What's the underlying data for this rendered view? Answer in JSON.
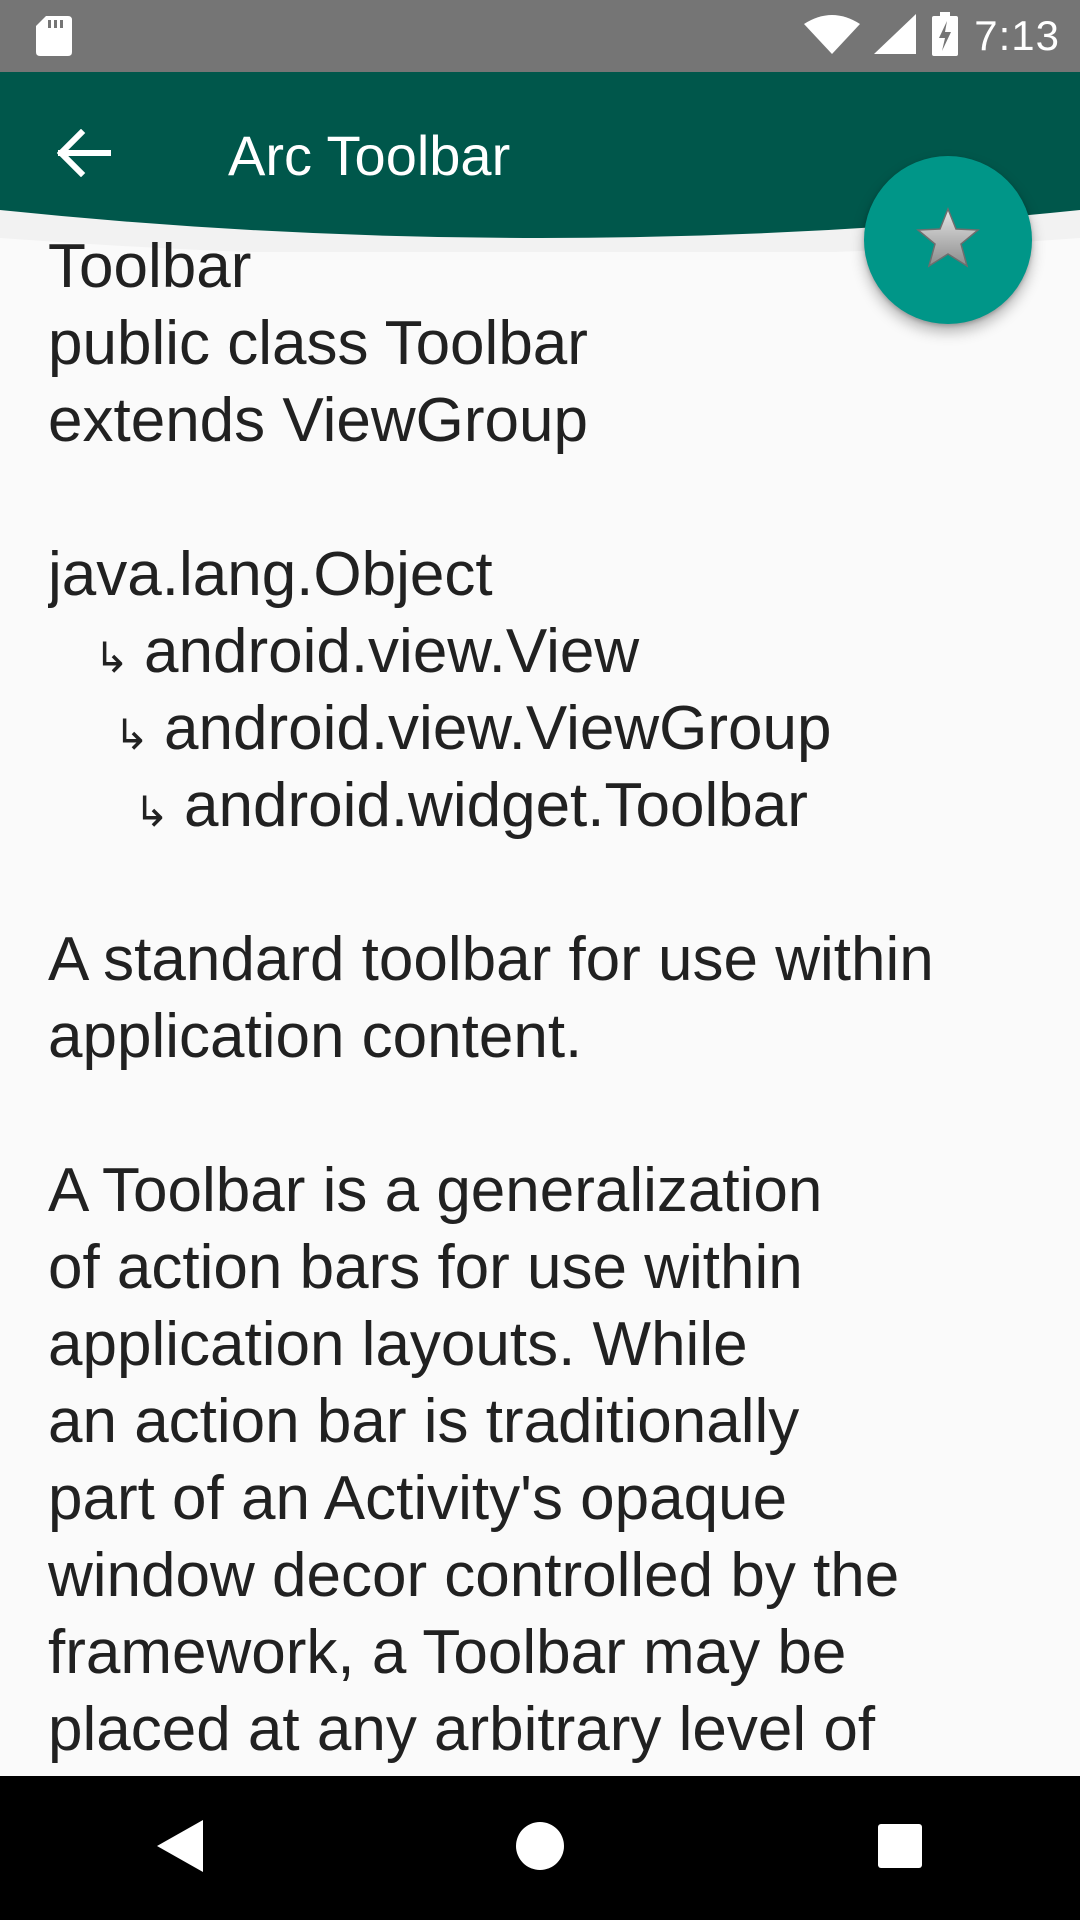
{
  "status_bar": {
    "time": "7:13",
    "icons": [
      "sd-card-icon",
      "wifi-icon",
      "signal-icon",
      "battery-charging-icon"
    ]
  },
  "toolbar": {
    "title": "Arc Toolbar",
    "back_icon": "arrow-back-icon",
    "background_color": "#00574B",
    "title_color": "#FFFFFF"
  },
  "fab": {
    "icon": "star-icon",
    "color": "#009688"
  },
  "content": {
    "class_name": "Toolbar",
    "declaration": [
      "public class Toolbar",
      "extends ViewGroup"
    ],
    "hierarchy": {
      "root": "java.lang.Object",
      "level1": "android.view.View",
      "level2": "android.view.ViewGroup",
      "level3": "android.widget.Toolbar",
      "arrow": "↳"
    },
    "summary": [
      "A standard toolbar for use within",
      "application content."
    ],
    "description": [
      "A Toolbar is a generalization",
      "of action bars for use within",
      "application layouts. While",
      "an action bar is traditionally",
      "part of an Activity's opaque",
      "window decor controlled by the",
      "framework, a Toolbar may be",
      "placed at any arbitrary level of"
    ]
  },
  "navigation_bar": {
    "buttons": [
      "nav-back-icon",
      "nav-home-icon",
      "nav-recents-icon"
    ]
  }
}
